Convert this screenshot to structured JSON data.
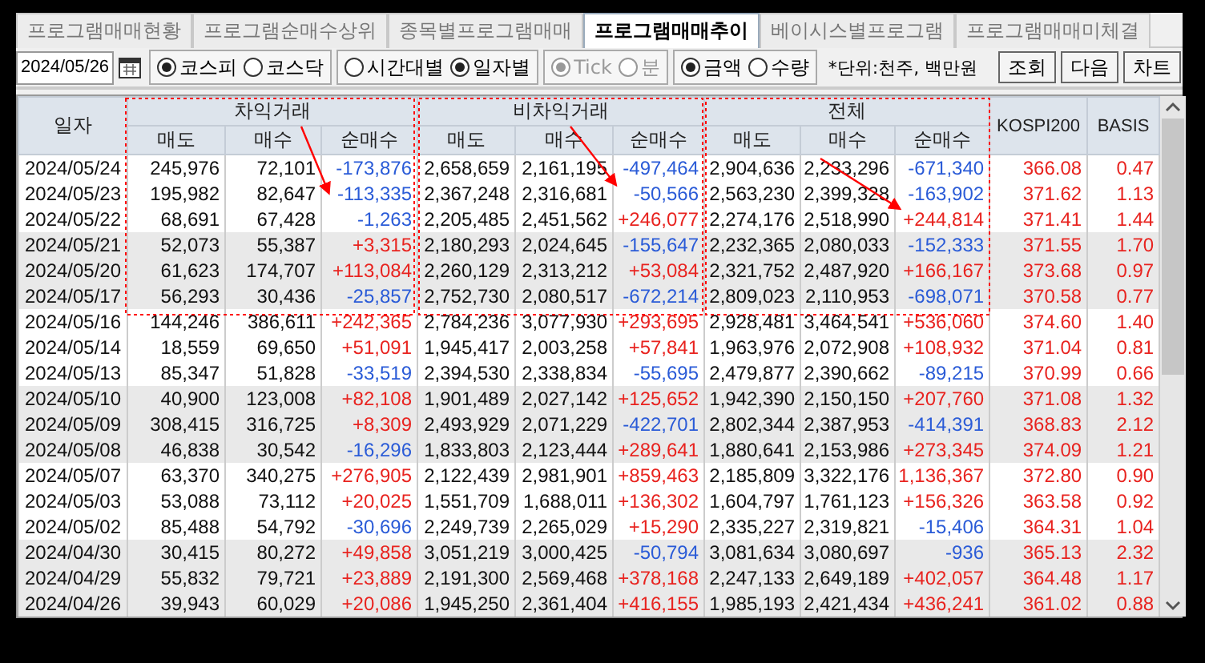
{
  "tabs": [
    {
      "label": "프로그램매매현황",
      "selected": false
    },
    {
      "label": "프로그램순매수상위",
      "selected": false
    },
    {
      "label": "종목별프로그램매매",
      "selected": false
    },
    {
      "label": "프로그램매매추이",
      "selected": true
    },
    {
      "label": "베이시스별프로그램",
      "selected": false
    },
    {
      "label": "프로그램매매미체결",
      "selected": false
    }
  ],
  "toolbar": {
    "date": "2024/05/26",
    "radio_groups": [
      {
        "disabled": false,
        "options": [
          {
            "label": "코스피",
            "selected": true
          },
          {
            "label": "코스닥",
            "selected": false
          }
        ]
      },
      {
        "disabled": false,
        "options": [
          {
            "label": "시간대별",
            "selected": false
          },
          {
            "label": "일자별",
            "selected": true
          }
        ]
      },
      {
        "disabled": true,
        "options": [
          {
            "label": "Tick",
            "selected": true
          },
          {
            "label": "분",
            "selected": false
          }
        ]
      },
      {
        "disabled": false,
        "options": [
          {
            "label": "금액",
            "selected": true
          },
          {
            "label": "수량",
            "selected": false
          }
        ]
      }
    ],
    "unit_note": "*단위:천주, 백만원",
    "buttons": [
      "조회",
      "다음",
      "차트"
    ]
  },
  "table": {
    "date_header": "일자",
    "groups": [
      {
        "label": "차익거래",
        "sub_columns": [
          "매도",
          "매수",
          "순매수"
        ]
      },
      {
        "label": "비차익거래",
        "sub_columns": [
          "매도",
          "매수",
          "순매수"
        ]
      },
      {
        "label": "전체",
        "sub_columns": [
          "매도",
          "매수",
          "순매수"
        ]
      }
    ],
    "extra_columns": [
      "KOSPI200",
      "BASIS"
    ],
    "rows": [
      {
        "date": "2024/05/24",
        "arb": [
          "245,976",
          "72,101",
          "-173,876"
        ],
        "arb_up": false,
        "nonarb": [
          "2,658,659",
          "2,161,195",
          "-497,464"
        ],
        "nonarb_up": false,
        "total": [
          "2,904,636",
          "2,233,296",
          "-671,340"
        ],
        "total_up": false,
        "kospi200": "366.08",
        "basis": "0.47"
      },
      {
        "date": "2024/05/23",
        "arb": [
          "195,982",
          "82,647",
          "-113,335"
        ],
        "arb_up": false,
        "nonarb": [
          "2,367,248",
          "2,316,681",
          "-50,566"
        ],
        "nonarb_up": false,
        "total": [
          "2,563,230",
          "2,399,328",
          "-163,902"
        ],
        "total_up": false,
        "kospi200": "371.62",
        "basis": "1.13"
      },
      {
        "date": "2024/05/22",
        "arb": [
          "68,691",
          "67,428",
          "-1,263"
        ],
        "arb_up": false,
        "nonarb": [
          "2,205,485",
          "2,451,562",
          "+246,077"
        ],
        "nonarb_up": true,
        "total": [
          "2,274,176",
          "2,518,990",
          "+244,814"
        ],
        "total_up": true,
        "kospi200": "371.41",
        "basis": "1.44"
      },
      {
        "date": "2024/05/21",
        "arb": [
          "52,073",
          "55,387",
          "+3,315"
        ],
        "arb_up": true,
        "nonarb": [
          "2,180,293",
          "2,024,645",
          "-155,647"
        ],
        "nonarb_up": false,
        "total": [
          "2,232,365",
          "2,080,033",
          "-152,333"
        ],
        "total_up": false,
        "kospi200": "371.55",
        "basis": "1.70"
      },
      {
        "date": "2024/05/20",
        "arb": [
          "61,623",
          "174,707",
          "+113,084"
        ],
        "arb_up": true,
        "nonarb": [
          "2,260,129",
          "2,313,212",
          "+53,084"
        ],
        "nonarb_up": true,
        "total": [
          "2,321,752",
          "2,487,920",
          "+166,167"
        ],
        "total_up": true,
        "kospi200": "373.68",
        "basis": "0.97"
      },
      {
        "date": "2024/05/17",
        "arb": [
          "56,293",
          "30,436",
          "-25,857"
        ],
        "arb_up": false,
        "nonarb": [
          "2,752,730",
          "2,080,517",
          "-672,214"
        ],
        "nonarb_up": false,
        "total": [
          "2,809,023",
          "2,110,953",
          "-698,071"
        ],
        "total_up": false,
        "kospi200": "370.58",
        "basis": "0.77"
      },
      {
        "date": "2024/05/16",
        "arb": [
          "144,246",
          "386,611",
          "+242,365"
        ],
        "arb_up": true,
        "nonarb": [
          "2,784,236",
          "3,077,930",
          "+293,695"
        ],
        "nonarb_up": true,
        "total": [
          "2,928,481",
          "3,464,541",
          "+536,060"
        ],
        "total_up": true,
        "kospi200": "374.60",
        "basis": "1.40"
      },
      {
        "date": "2024/05/14",
        "arb": [
          "18,559",
          "69,650",
          "+51,091"
        ],
        "arb_up": true,
        "nonarb": [
          "1,945,417",
          "2,003,258",
          "+57,841"
        ],
        "nonarb_up": true,
        "total": [
          "1,963,976",
          "2,072,908",
          "+108,932"
        ],
        "total_up": true,
        "kospi200": "371.04",
        "basis": "0.81"
      },
      {
        "date": "2024/05/13",
        "arb": [
          "85,347",
          "51,828",
          "-33,519"
        ],
        "arb_up": false,
        "nonarb": [
          "2,394,530",
          "2,338,834",
          "-55,695"
        ],
        "nonarb_up": false,
        "total": [
          "2,479,877",
          "2,390,662",
          "-89,215"
        ],
        "total_up": false,
        "kospi200": "370.99",
        "basis": "0.66"
      },
      {
        "date": "2024/05/10",
        "arb": [
          "40,900",
          "123,008",
          "+82,108"
        ],
        "arb_up": true,
        "nonarb": [
          "1,901,489",
          "2,027,142",
          "+125,652"
        ],
        "nonarb_up": true,
        "total": [
          "1,942,390",
          "2,150,150",
          "+207,760"
        ],
        "total_up": true,
        "kospi200": "371.08",
        "basis": "1.32"
      },
      {
        "date": "2024/05/09",
        "arb": [
          "308,415",
          "316,725",
          "+8,309"
        ],
        "arb_up": true,
        "nonarb": [
          "2,493,929",
          "2,071,229",
          "-422,701"
        ],
        "nonarb_up": false,
        "total": [
          "2,802,344",
          "2,387,953",
          "-414,391"
        ],
        "total_up": false,
        "kospi200": "368.83",
        "basis": "2.12"
      },
      {
        "date": "2024/05/08",
        "arb": [
          "46,838",
          "30,542",
          "-16,296"
        ],
        "arb_up": false,
        "nonarb": [
          "1,833,803",
          "2,123,444",
          "+289,641"
        ],
        "nonarb_up": true,
        "total": [
          "1,880,641",
          "2,153,986",
          "+273,345"
        ],
        "total_up": true,
        "kospi200": "374.09",
        "basis": "1.21"
      },
      {
        "date": "2024/05/07",
        "arb": [
          "63,370",
          "340,275",
          "+276,905"
        ],
        "arb_up": true,
        "nonarb": [
          "2,122,439",
          "2,981,901",
          "+859,463"
        ],
        "nonarb_up": true,
        "total": [
          "2,185,809",
          "3,322,176",
          "1,136,367"
        ],
        "total_up": true,
        "kospi200": "372.80",
        "basis": "0.90"
      },
      {
        "date": "2024/05/03",
        "arb": [
          "53,088",
          "73,112",
          "+20,025"
        ],
        "arb_up": true,
        "nonarb": [
          "1,551,709",
          "1,688,011",
          "+136,302"
        ],
        "nonarb_up": true,
        "total": [
          "1,604,797",
          "1,761,123",
          "+156,326"
        ],
        "total_up": true,
        "kospi200": "363.58",
        "basis": "0.92"
      },
      {
        "date": "2024/05/02",
        "arb": [
          "85,488",
          "54,792",
          "-30,696"
        ],
        "arb_up": false,
        "nonarb": [
          "2,249,739",
          "2,265,029",
          "+15,290"
        ],
        "nonarb_up": true,
        "total": [
          "2,335,227",
          "2,319,821",
          "-15,406"
        ],
        "total_up": false,
        "kospi200": "364.31",
        "basis": "1.04"
      },
      {
        "date": "2024/04/30",
        "arb": [
          "30,415",
          "80,272",
          "+49,858"
        ],
        "arb_up": true,
        "nonarb": [
          "3,051,219",
          "3,000,425",
          "-50,794"
        ],
        "nonarb_up": false,
        "total": [
          "3,081,634",
          "3,080,697",
          "-936"
        ],
        "total_up": false,
        "kospi200": "365.13",
        "basis": "2.32"
      },
      {
        "date": "2024/04/29",
        "arb": [
          "55,832",
          "79,721",
          "+23,889"
        ],
        "arb_up": true,
        "nonarb": [
          "2,191,300",
          "2,569,468",
          "+378,168"
        ],
        "nonarb_up": true,
        "total": [
          "2,247,133",
          "2,649,189",
          "+402,057"
        ],
        "total_up": true,
        "kospi200": "364.48",
        "basis": "1.17"
      },
      {
        "date": "2024/04/26",
        "arb": [
          "39,943",
          "60,029",
          "+20,086"
        ],
        "arb_up": true,
        "nonarb": [
          "1,945,250",
          "2,361,404",
          "+416,155"
        ],
        "nonarb_up": true,
        "total": [
          "1,985,193",
          "2,421,434",
          "+436,241"
        ],
        "total_up": true,
        "kospi200": "361.02",
        "basis": "0.88"
      }
    ]
  }
}
